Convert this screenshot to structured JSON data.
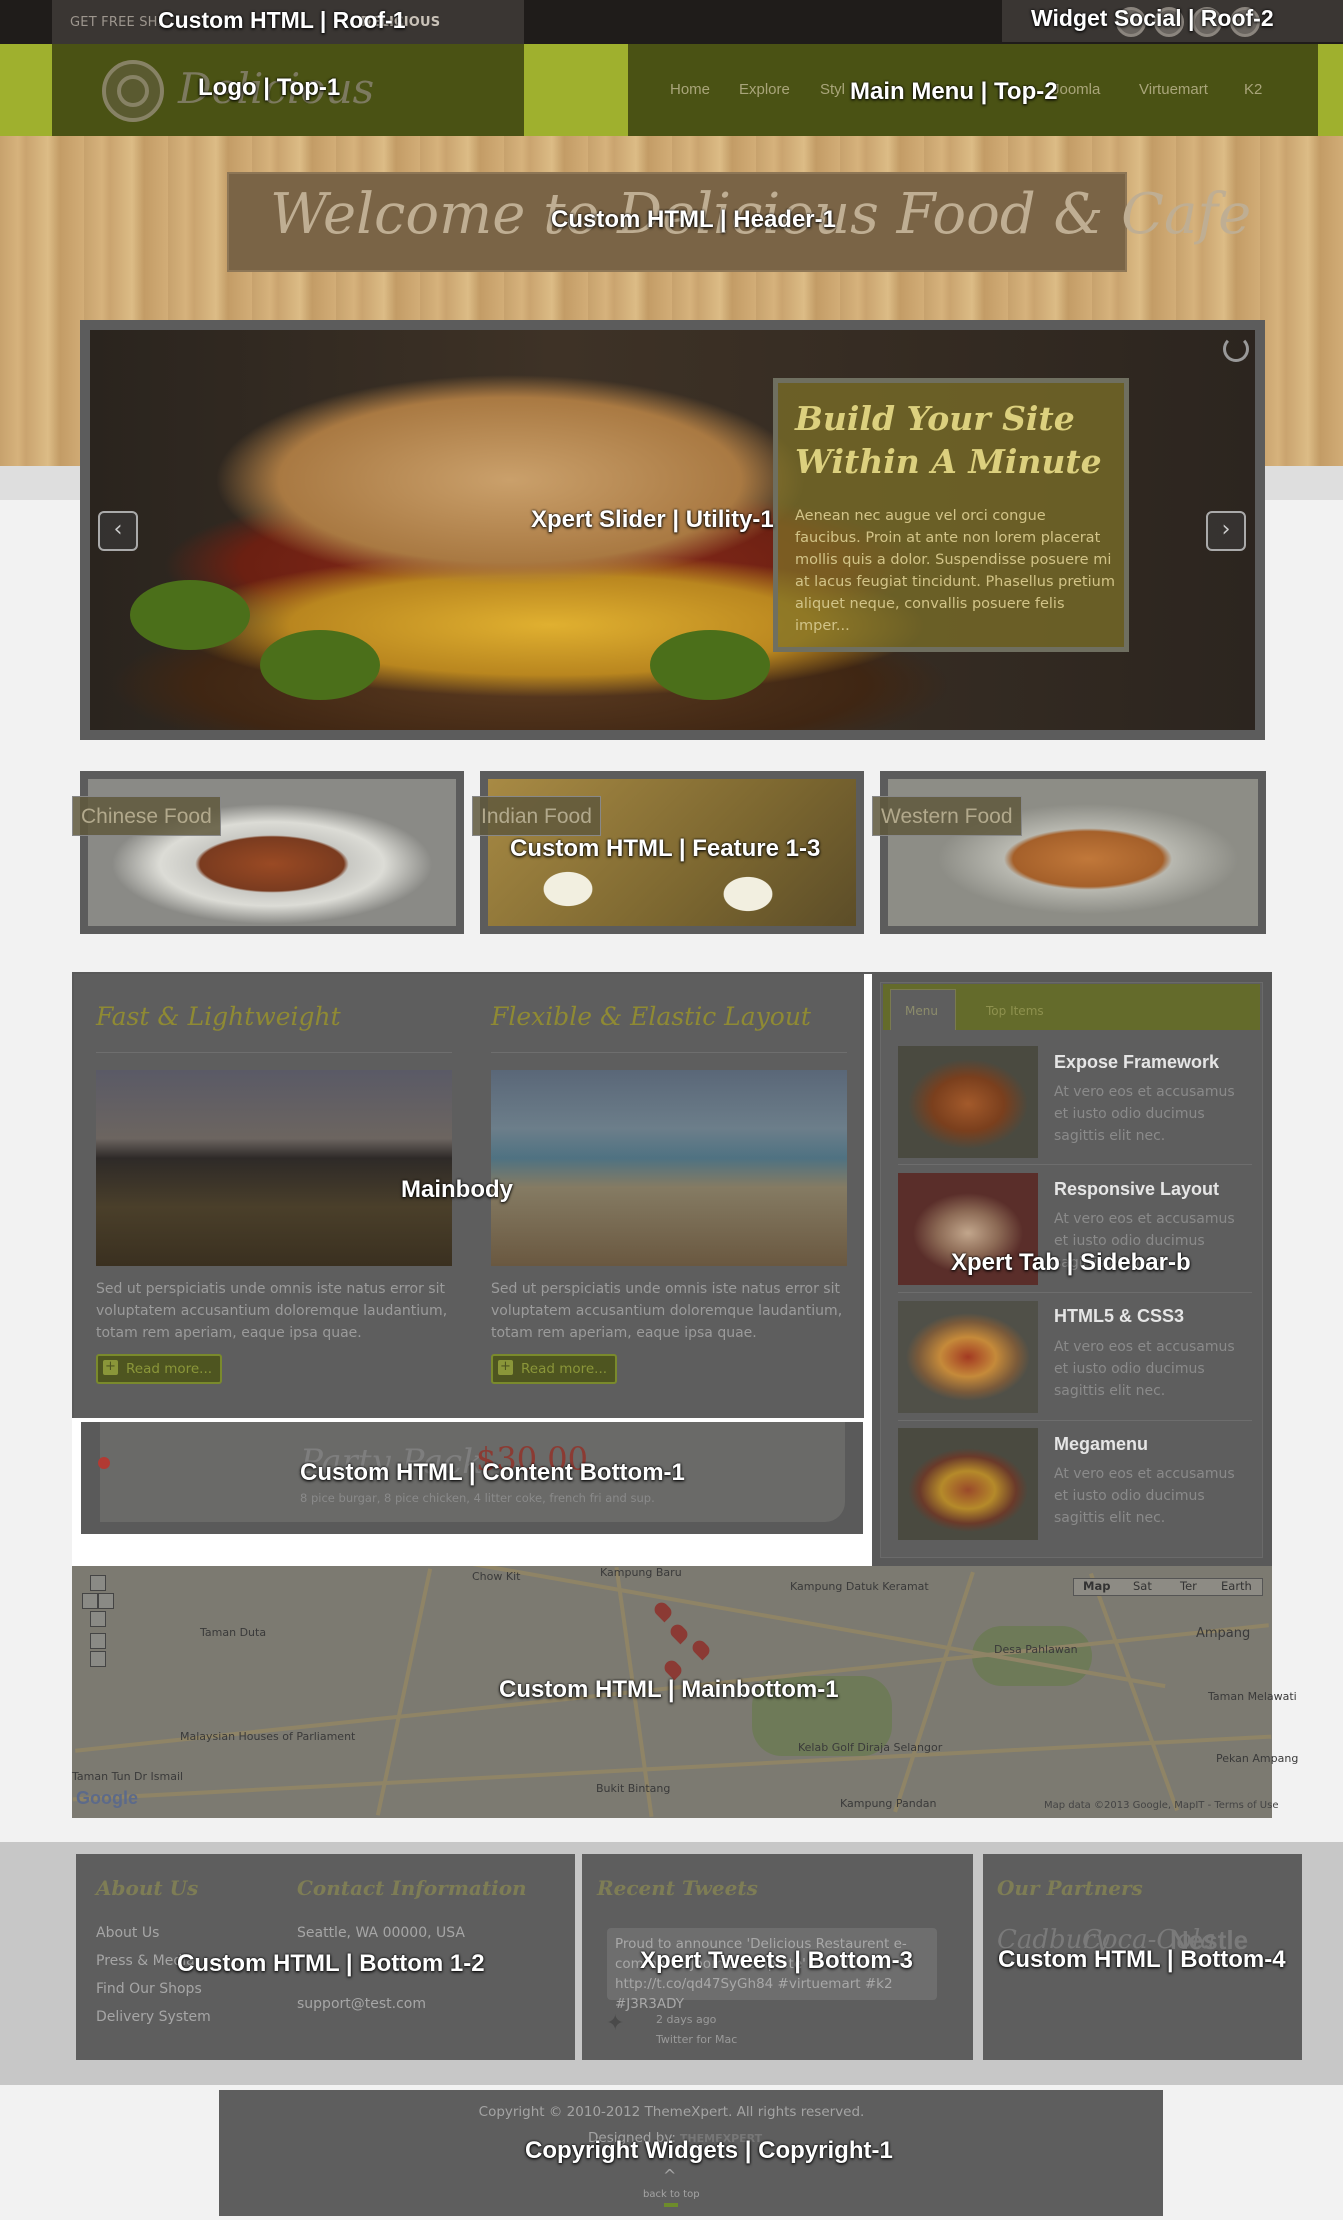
{
  "roof": {
    "left_text_prefix": "GET FREE SHI",
    "left_text_suffix": "DELICIOUS",
    "label_left": "Custom HTML | Roof-1",
    "label_right": "Widget Social | Roof-2"
  },
  "top": {
    "logo_word": "Delicious",
    "logo_label": "Logo | Top-1",
    "menu_label": "Main Menu | Top-2",
    "menu_items": [
      "Home",
      "Explore",
      "Styl",
      "Joomla",
      "Virtuemart",
      "K2"
    ]
  },
  "header": {
    "welcome_text": "Welcome to Delicious Food & Cafe",
    "label": "Custom HTML | Header-1"
  },
  "slider": {
    "label": "Xpert Slider | Utility-1",
    "caption_title": "Build Your Site Within A Minute",
    "caption_body": "Aenean nec augue vel orci congue faucibus. Proin at ante non lorem placerat mollis quis a dolor. Suspendisse posuere mi at lacus feugiat tincidunt. Phasellus pretium aliquet neque, convallis posuere felis imper...",
    "prev": "‹",
    "next": "›"
  },
  "features": {
    "label": "Custom HTML | Feature 1-3",
    "items": [
      "Chinese Food",
      "Indian Food",
      "Western Food"
    ]
  },
  "mainbody": {
    "label": "Mainbody",
    "columns": [
      {
        "title": "Fast & Lightweight",
        "text": "Sed ut perspiciatis unde omnis iste natus error sit voluptatem accusantium doloremque laudantium, totam rem aperiam, eaque ipsa quae.",
        "button": "Read more..."
      },
      {
        "title": "Flexible & Elastic Layout",
        "text": "Sed ut perspiciatis unde omnis iste natus error sit voluptatem accusantium doloremque laudantium, totam rem aperiam, eaque ipsa quae.",
        "button": "Read more..."
      }
    ]
  },
  "content_bottom": {
    "label": "Custom HTML | Content Bottom-1",
    "title": "Party Pack",
    "price": "$30.00",
    "desc": "8 pice burgar, 8 pice chicken, 4 litter coke, french fri and sup."
  },
  "sidebar": {
    "label": "Xpert Tab | Sidebar-b",
    "tabs": [
      "Menu",
      "Top Items"
    ],
    "items": [
      {
        "title": "Expose Framework",
        "desc": "At vero eos et accusamus et iusto odio ducimus sagittis elit nec."
      },
      {
        "title": "Responsive Layout",
        "desc": "At vero eos et accusamus et iusto odio ducimus sagittis elit nec."
      },
      {
        "title": "HTML5 & CSS3",
        "desc": "At vero eos et accusamus et iusto odio ducimus sagittis elit nec."
      },
      {
        "title": "Megamenu",
        "desc": "At vero eos et accusamus et iusto odio ducimus sagittis elit nec."
      }
    ]
  },
  "map": {
    "label": "Custom HTML | Mainbottom-1",
    "types": [
      "Map",
      "Sat",
      "Ter",
      "Earth"
    ],
    "google": "Google",
    "copyright": "Map data ©2013 Google, MapIT - Terms of Use",
    "places": [
      "Taman Duta",
      "Kampung Baru",
      "Ampang",
      "Taman Melawati",
      "Kampung Datuk Keramat",
      "Desa Pahlawan",
      "Kelab Golf Diraja Selangor",
      "Bukit Bintang",
      "Kampung Pandan",
      "Pekan Ampang",
      "Malaysian Houses of Parliament",
      "Taman Tun Dr Ismail",
      "Chow Kit"
    ]
  },
  "bottom": {
    "about": {
      "title": "About Us",
      "links": [
        "About Us",
        "Press & Media",
        "Find Our Shops",
        "Delivery System"
      ]
    },
    "contact": {
      "title": "Contact Information",
      "address": "Seattle, WA 00000, USA",
      "email": "support@test.com"
    },
    "label_12": "Custom HTML | Bottom 1-2",
    "tweets": {
      "title": "Recent Tweets",
      "text": "Proud to announce 'Delicious Restaurent e-commerce Joomla Template' http://t.co/qd47SyGh84 #virtuemart #k2 #J3R3ADY",
      "time": "2 days ago",
      "via": "Twitter for Mac",
      "label": "Xpert Tweets | Bottom-3"
    },
    "partners": {
      "title": "Our Partners",
      "names": [
        "Cadbury",
        "Coca-Cola",
        "Nestle"
      ],
      "label": "Custom HTML | Bottom-4"
    }
  },
  "copyright": {
    "text": "Copyright © 2010-2012 ThemeXpert. All rights reserved.",
    "designed_by": "Designed by:",
    "designer": "THEMEXPERT",
    "back_to_top": "back to top",
    "label": "Copyright Widgets | Copyright-1"
  }
}
